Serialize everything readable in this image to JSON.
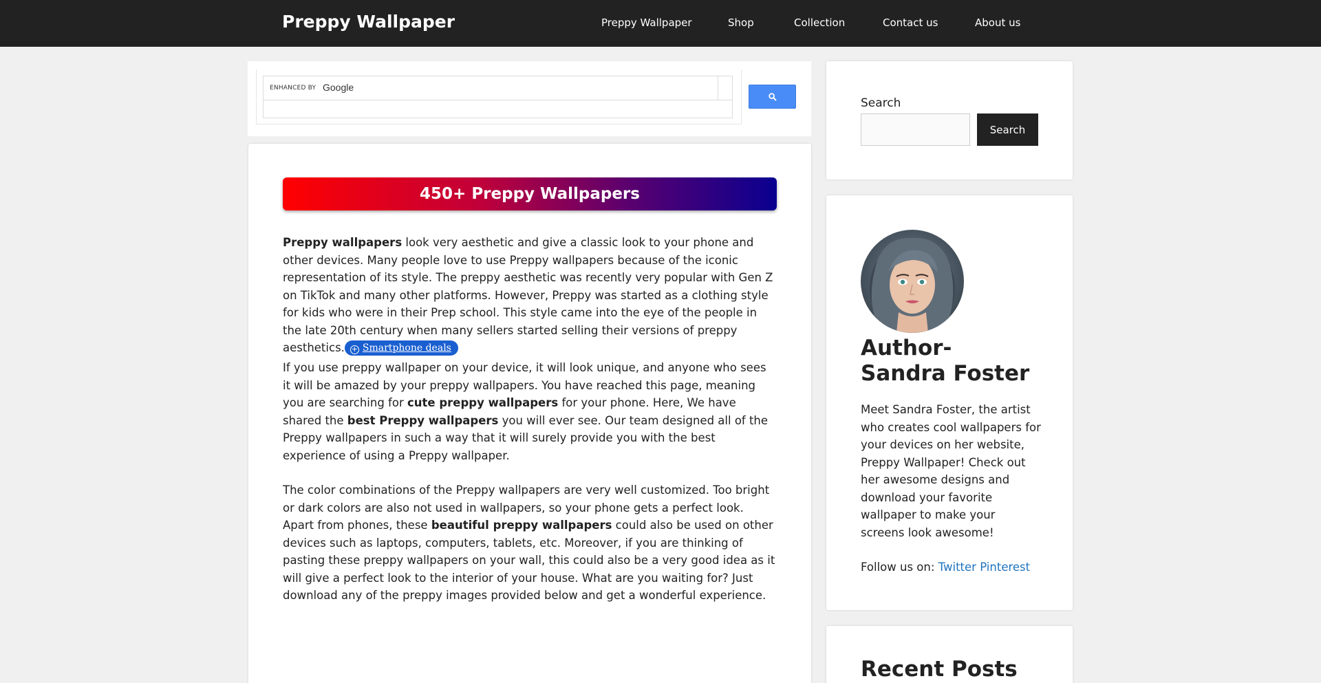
{
  "header": {
    "site_title": "Preppy Wallpaper",
    "nav": [
      "Preppy Wallpaper",
      "Shop",
      "Collection",
      "Contact us",
      "About us"
    ]
  },
  "google_search": {
    "enhanced_by": "ENHANCED BY",
    "logo_text": "Google",
    "search_icon": "magnifier-icon"
  },
  "article": {
    "banner_title": "450+ Preppy Wallpapers",
    "p1": {
      "bold_lead": "Preppy wallpapers",
      "text": " look very aesthetic and give a classic look to your phone and other devices. Many people love to use Preppy wallpapers because of the iconic representation of its style. The preppy aesthetic was recently very popular with Gen Z on TikTok and many other platforms. However, Preppy was started as a clothing style for kids who were in their Prep school. This style came into the eye of the people in the late 20th century when many sellers started selling their versions of preppy aesthetics.",
      "deal_pill": "Smartphone deals"
    },
    "p2": {
      "a": "If you use preppy wallpaper on your device, it will look unique, and anyone who sees it will be amazed by your preppy wallpapers. You have reached this page, meaning you are searching for ",
      "b": "cute preppy wallpapers",
      "c": " for your phone. Here, We have shared the ",
      "d": "best Preppy wallpapers",
      "e": " you will ever see. Our team designed all of the Preppy wallpapers in such a way that it will surely provide you with the best experience of using a Preppy wallpaper."
    },
    "p3": {
      "a": "The color combinations of the Preppy wallpapers are very well customized. Too bright or dark colors are also not used in wallpapers, so your phone gets a perfect look. Apart from phones, these ",
      "b": "beautiful preppy wallpapers",
      "c": " could also be used on other devices such as laptops, computers, tablets, etc. Moreover, if you are thinking of pasting these preppy wallpapers on your wall, this could also be a very good idea as it will give a perfect look to the interior of your house. What are you waiting for? Just download any of the preppy images provided below and get a wonderful experience."
    }
  },
  "sidebar": {
    "search_label": "Search",
    "search_button": "Search",
    "author_title": "Author- Sandra Foster",
    "author_bio": "Meet Sandra Foster, the artist who creates cool wallpapers for your devices on her website, Preppy Wallpaper! Check out her awesome designs and download your favorite wallpaper to make your screens look awesome!",
    "follow_label": "Follow us on: ",
    "follow_links": [
      "Twitter",
      "Pinterest"
    ],
    "recent_posts_title": "Recent Posts"
  },
  "colors": {
    "header_bg": "#222222",
    "page_bg": "#f0f0f0",
    "link": "#1e73be",
    "google_button": "#4a8cf7",
    "banner_start": "#ff0000",
    "banner_end": "#0a0090"
  }
}
